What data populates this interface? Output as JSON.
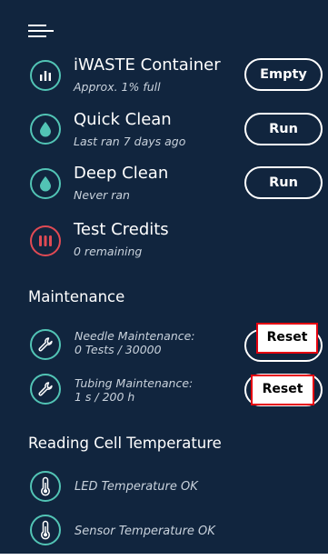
{
  "menu": {
    "icon": "hamburger-menu-icon"
  },
  "items": [
    {
      "title": "iWASTE Container",
      "subtitle": "Approx. 1% full",
      "button": "Empty",
      "icon": "bar-chart-icon"
    },
    {
      "title": "Quick Clean",
      "subtitle": "Last ran 7 days ago",
      "button": "Run",
      "icon": "droplet-icon"
    },
    {
      "title": "Deep Clean",
      "subtitle": "Never ran",
      "button": "Run",
      "icon": "droplet-icon"
    },
    {
      "title": "Test Credits",
      "subtitle": "0 remaining",
      "icon": "test-tubes-icon"
    }
  ],
  "maintenance": {
    "heading": "Maintenance",
    "items": [
      {
        "title": "Needle Maintenance:",
        "subtitle": "0 Tests / 30000",
        "button": "Reset",
        "icon": "wrench-icon"
      },
      {
        "title": "Tubing Maintenance:",
        "subtitle": "1 s / 200 h",
        "button": "Reset",
        "icon": "wrench-icon"
      }
    ]
  },
  "temperature": {
    "heading": "Reading Cell Temperature",
    "items": [
      {
        "label": "LED Temperature OK",
        "icon": "thermometer-icon"
      },
      {
        "label": "Sensor Temperature OK",
        "icon": "thermometer-icon"
      }
    ]
  },
  "colors": {
    "background": "#11253e",
    "accent": "#52c4b5",
    "alert": "#e04a54",
    "highlight": "#e5000f"
  }
}
